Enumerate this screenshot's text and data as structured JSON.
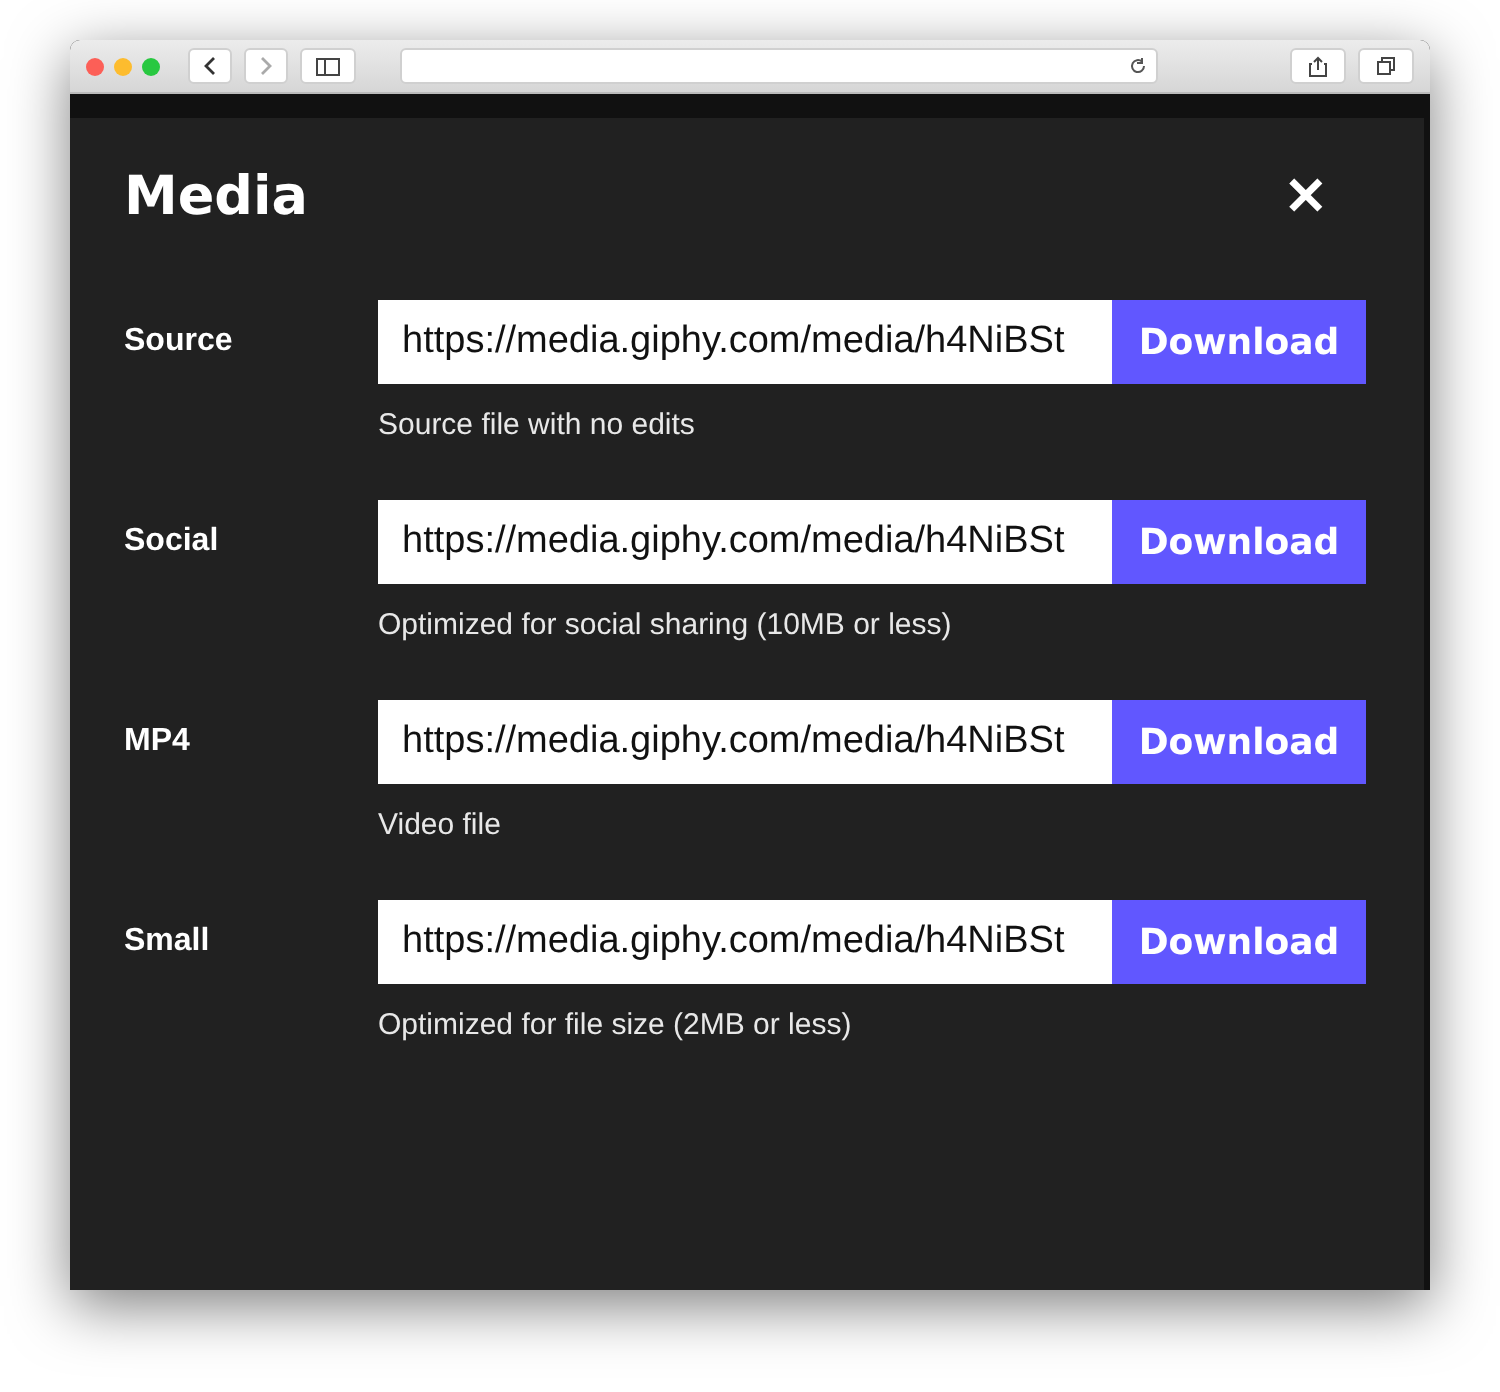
{
  "title": "Media",
  "close": "✕",
  "rows": [
    {
      "label": "Source",
      "url": "https://media.giphy.com/media/h4NiBSt",
      "button": "Download",
      "hint": "Source file with no edits"
    },
    {
      "label": "Social",
      "url": "https://media.giphy.com/media/h4NiBSt",
      "button": "Download",
      "hint": "Optimized for social sharing (10MB or less)"
    },
    {
      "label": "MP4",
      "url": "https://media.giphy.com/media/h4NiBSt",
      "button": "Download",
      "hint": "Video file"
    },
    {
      "label": "Small",
      "url": "https://media.giphy.com/media/h4NiBSt",
      "button": "Download",
      "hint": "Optimized for file size (2MB or less)"
    }
  ]
}
